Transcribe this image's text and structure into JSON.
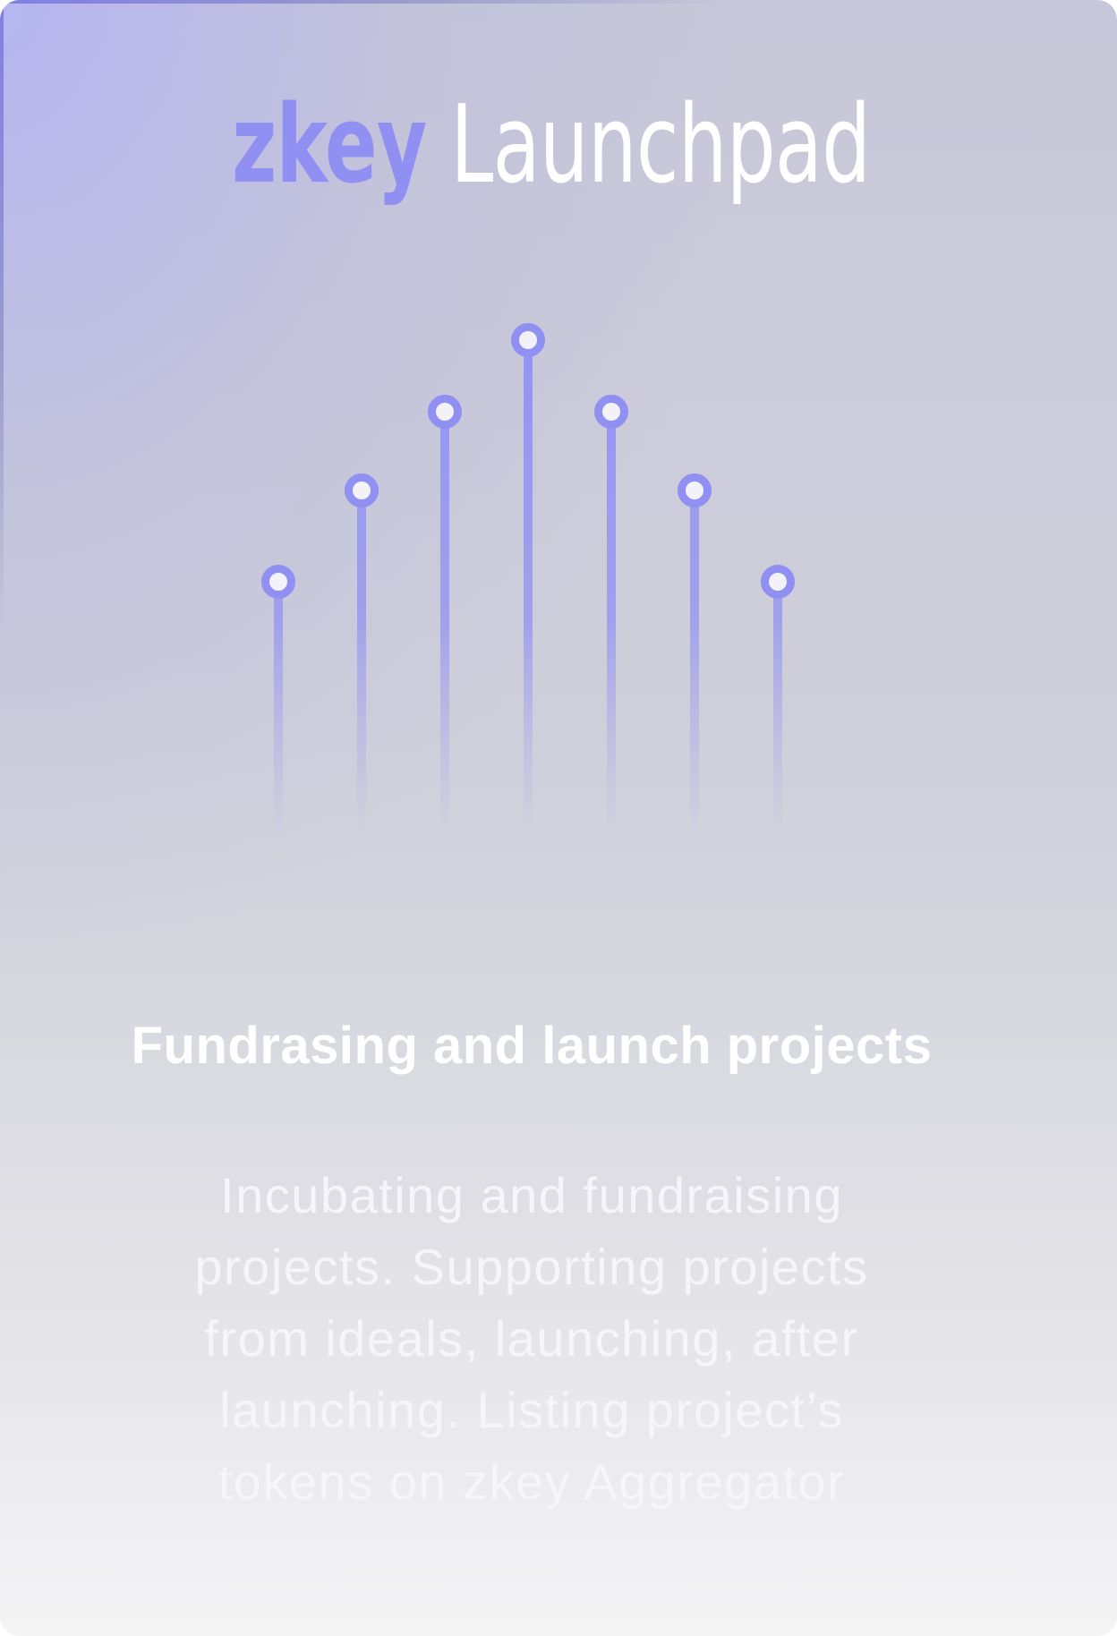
{
  "card": {
    "title_brand": "zkey",
    "title_rest": "Launchpad",
    "subtitle": "Fundrasing and launch projects",
    "description": "Incubating and fundraising projects. Supporting projects from ideals, launching, after launching. Listing project’s tokens on zkey Aggregator"
  },
  "illustration": {
    "icon": "launch-pins-icon",
    "pin_count": 7
  },
  "colors": {
    "accent": "#9090f2",
    "text": "#ffffff",
    "background_top": "#b8b8f0",
    "background_bottom": "#f4f4f5"
  }
}
